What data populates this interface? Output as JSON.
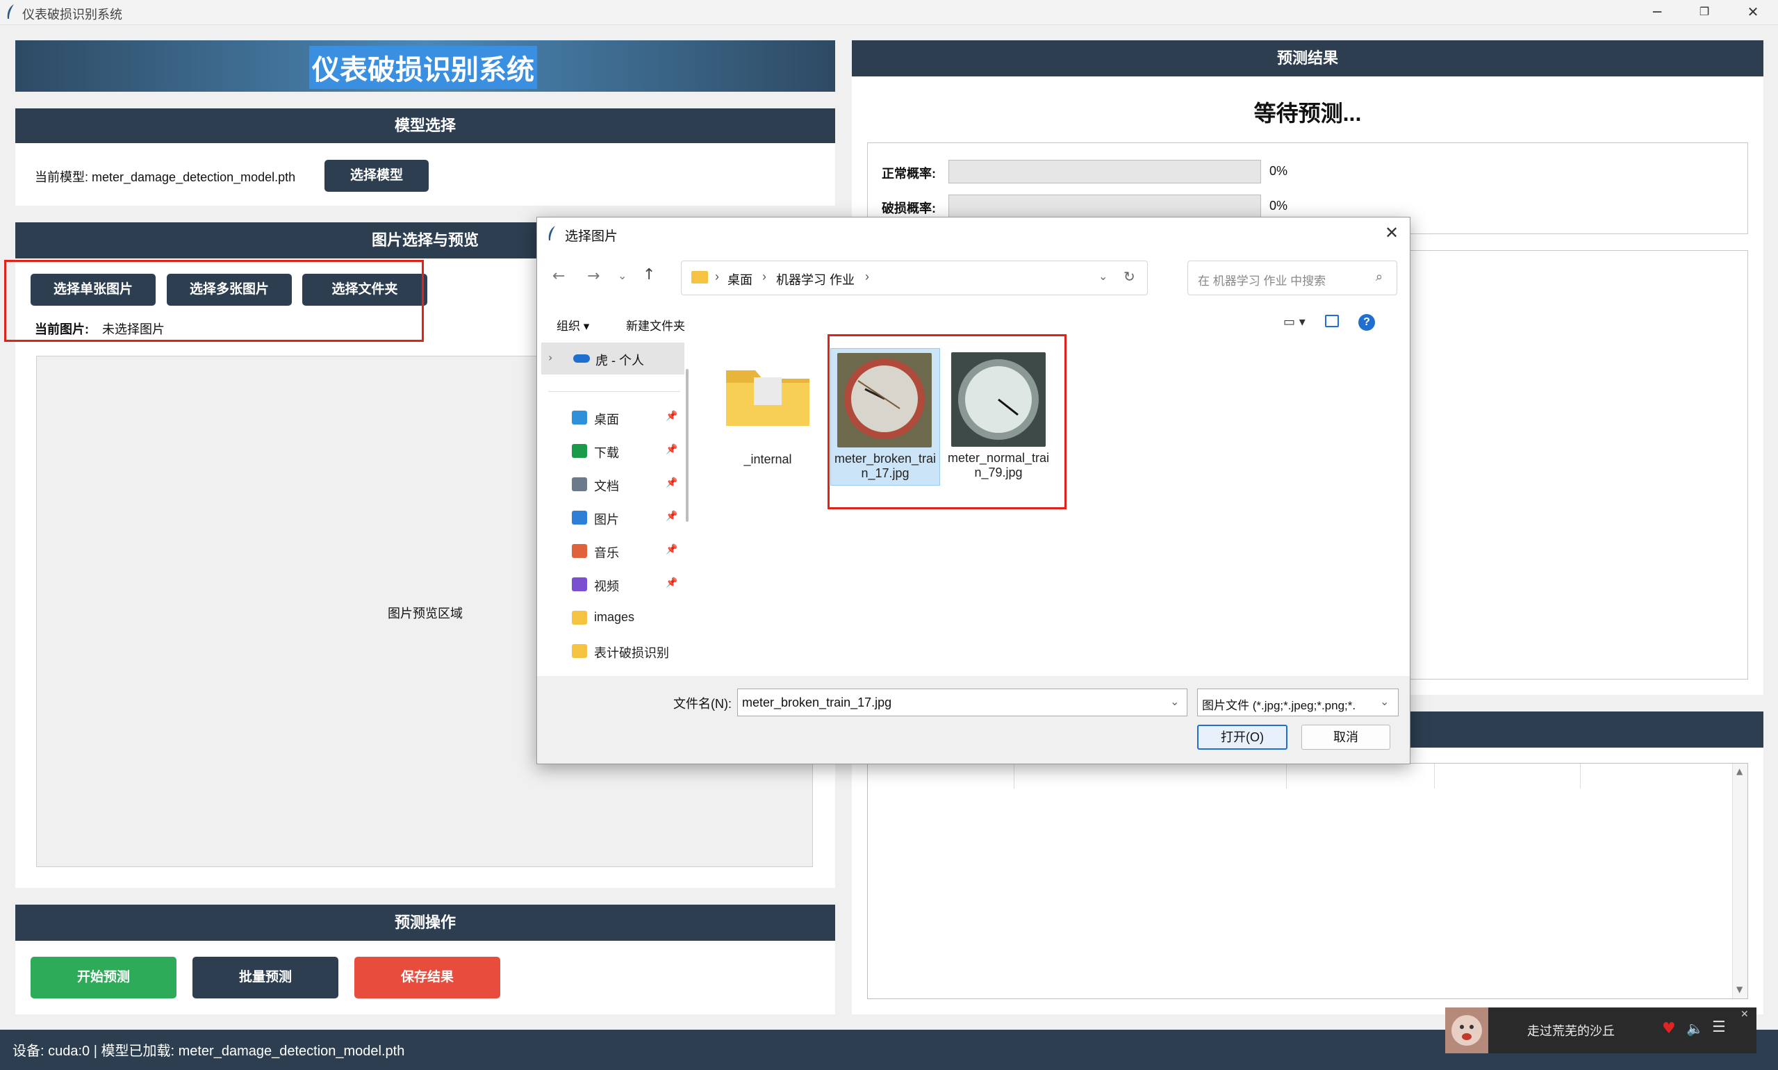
{
  "window": {
    "title": "仪表破损识别系统"
  },
  "app": {
    "title": "仪表破损识别系统"
  },
  "model_section": {
    "header": "模型选择",
    "current_model": "当前模型: meter_damage_detection_model.pth",
    "select_button": "选择模型"
  },
  "image_section": {
    "header": "图片选择与预览",
    "buttons": [
      "选择单张图片",
      "选择多张图片",
      "选择文件夹"
    ],
    "current_label": "当前图片:",
    "current_value": "未选择图片",
    "preview_placeholder": "图片预览区域"
  },
  "predict_ops": {
    "header": "预测操作",
    "start": "开始预测",
    "batch": "批量预测",
    "save": "保存结果"
  },
  "status_bar": "设备: cuda:0 | 模型已加载: meter_damage_detection_model.pth",
  "results": {
    "header": "预测结果",
    "waiting": "等待预测...",
    "normal_label": "正常概率:",
    "normal_pct": "0%",
    "normal_value": 0,
    "broken_label": "破损概率:",
    "broken_pct": "0%",
    "broken_value": 0
  },
  "dialog": {
    "title": "选择图片",
    "breadcrumb": [
      "桌面",
      "机器学习 作业"
    ],
    "search_placeholder": "在 机器学习 作业 中搜索",
    "toolbar": {
      "organize": "组织 ▾",
      "new_folder": "新建文件夹"
    },
    "nav": {
      "onedrive": "虎 - 个人",
      "items": [
        {
          "label": "桌面",
          "icon": "desktop-icon",
          "color": "#2f8fd8"
        },
        {
          "label": "下载",
          "icon": "download-icon",
          "color": "#1a9a4a"
        },
        {
          "label": "文档",
          "icon": "document-icon",
          "color": "#6b7b8c"
        },
        {
          "label": "图片",
          "icon": "pictures-icon",
          "color": "#2f7fd8"
        },
        {
          "label": "音乐",
          "icon": "music-icon",
          "color": "#e0623a"
        },
        {
          "label": "视频",
          "icon": "video-icon",
          "color": "#7a4fd0"
        },
        {
          "label": "images",
          "icon": "folder-icon",
          "color": "#f5c242"
        },
        {
          "label": "表计破损识别",
          "icon": "folder-icon",
          "color": "#f5c242"
        }
      ]
    },
    "files": [
      {
        "name": "_internal",
        "type": "folder"
      },
      {
        "name": "meter_broken_train_17.jpg",
        "type": "image"
      },
      {
        "name": "meter_normal_train_79.jpg",
        "type": "image"
      }
    ],
    "filename_label": "文件名(N):",
    "filename_value": "meter_broken_train_17.jpg",
    "filetype": "图片文件 (*.jpg;*.jpeg;*.png;*.",
    "open": "打开(O)",
    "cancel": "取消"
  },
  "music_widget": {
    "song": "走过荒芜的沙丘"
  }
}
